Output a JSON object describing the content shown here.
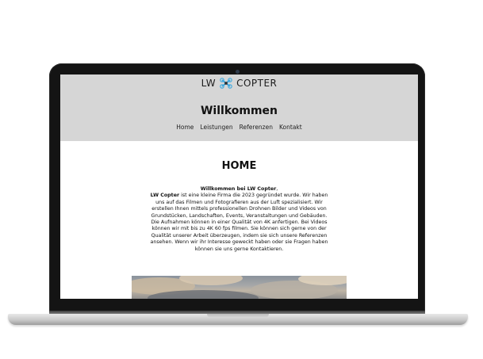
{
  "site": {
    "logo": "LW COPTER",
    "logo_accent_color": "#3aa9e0",
    "title": "Willkommen",
    "nav": [
      {
        "label": "Home"
      },
      {
        "label": "Leistungen"
      },
      {
        "label": "Referenzen"
      },
      {
        "label": "Kontakt"
      }
    ]
  },
  "main": {
    "heading": "HOME",
    "intro_greeting": "Willkommen bei LW Copter",
    "intro_greeting_suffix": ",",
    "intro_brand": "LW Copter",
    "intro_body": "ist eine kleine Firma die 2023 gegründet wurde. Wir haben uns auf das Filmen und Fotografieren aus der Luft spezialisiert. Wir erstellen Ihnen mittels professionellen Drohnen Bilder und Videos von Grundstücken, Landschaften, Events, Veranstaltungen und Gebäuden. Die Aufnahmen können in einer Qualität von 4K anfertigen. Bei Videos können wir mit bis zu 4K 60 fps filmen. Sie können sich gerne von der Qualität unserer Arbeit überzeugen, indem sie sich unsere Referenzen ansehen. Wenn wir ihr Interesse geweckt haben oder sie Fragen haben können sie uns gerne Kontaktieren."
  }
}
